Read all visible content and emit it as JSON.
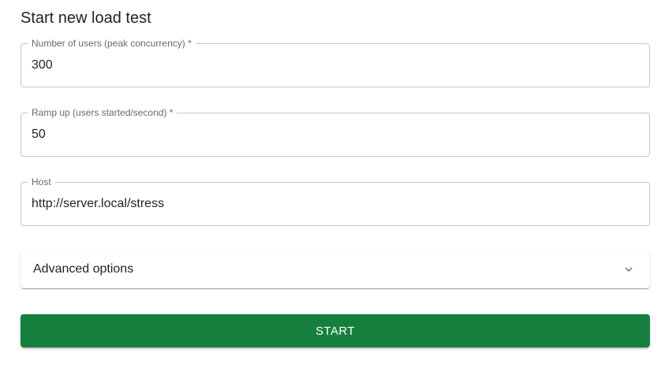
{
  "form": {
    "title": "Start new load test",
    "fields": [
      {
        "label": "Number of users (peak concurrency) *",
        "value": "300"
      },
      {
        "label": "Ramp up (users started/second) *",
        "value": "50"
      },
      {
        "label": "Host",
        "value": "http://server.local/stress"
      }
    ],
    "advanced": {
      "label": "Advanced options",
      "icon": "chevron-down-icon",
      "expanded": false
    },
    "start_label": "Start"
  },
  "colors": {
    "primary_button": "#15803d",
    "outline": "#c4c4c4",
    "text": "#212121"
  }
}
